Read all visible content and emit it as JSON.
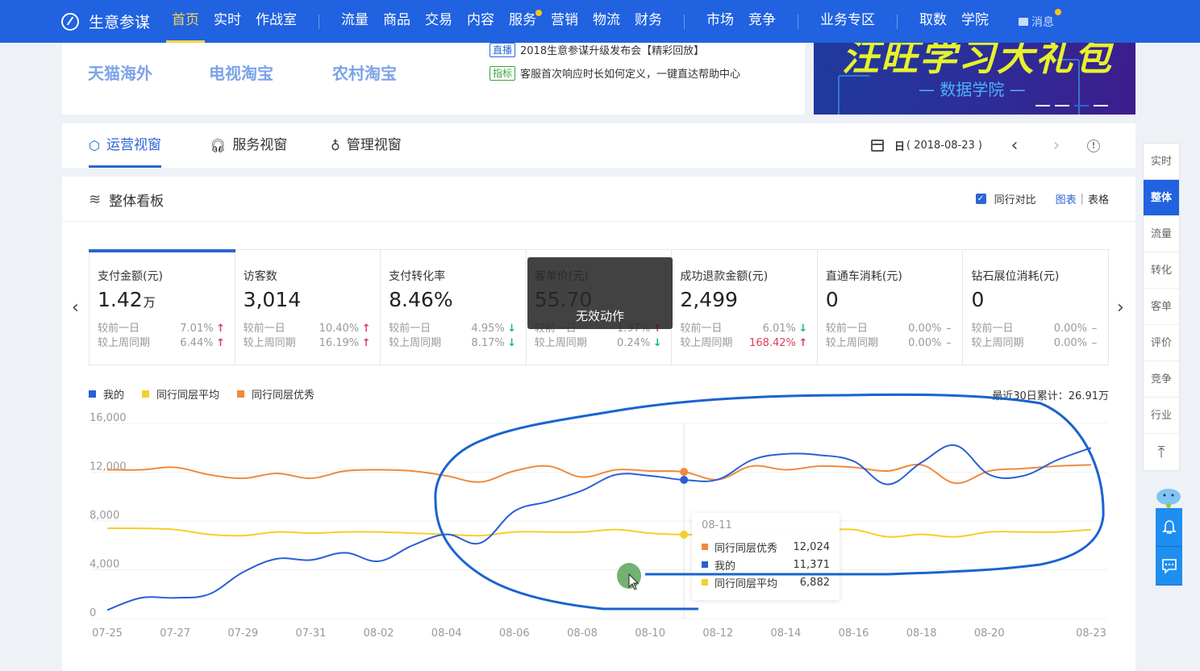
{
  "topnav": {
    "brand": "生意参谋",
    "groups": [
      [
        {
          "label": "首页",
          "active": true
        },
        {
          "label": "实时"
        },
        {
          "label": "作战室"
        }
      ],
      [
        {
          "label": "流量"
        },
        {
          "label": "商品"
        },
        {
          "label": "交易"
        },
        {
          "label": "内容"
        },
        {
          "label": "服务",
          "dot": true
        },
        {
          "label": "营销"
        },
        {
          "label": "物流"
        },
        {
          "label": "财务"
        }
      ],
      [
        {
          "label": "市场"
        },
        {
          "label": "竞争"
        }
      ],
      [
        {
          "label": "业务专区"
        }
      ],
      [
        {
          "label": "取数"
        },
        {
          "label": "学院"
        }
      ]
    ],
    "message_label": "消息",
    "accent_color": "#2062e0"
  },
  "quick_links": [
    "天猫海外",
    "电视淘宝",
    "农村淘宝"
  ],
  "news": [
    {
      "tag": "直播",
      "tag_color": "#2a66d6",
      "text": "2018生意参谋升级发布会【精彩回放】"
    },
    {
      "tag": "指标",
      "tag_color": "#3aa33a",
      "text": "客服首次响应时长如何定义，一键直达帮助中心"
    }
  ],
  "banner": {
    "title": "汪旺学习大礼包",
    "subtitle": "— 数据学院 —",
    "slides": 4,
    "current_slide": 3
  },
  "view_tabs": [
    {
      "label": "运营视窗",
      "icon": "shield-icon",
      "active": true
    },
    {
      "label": "服务视窗",
      "icon": "headset-icon"
    },
    {
      "label": "管理视窗",
      "icon": "tie-icon"
    }
  ],
  "date_picker": {
    "period": "日",
    "date": "( 2018-08-23 )"
  },
  "dashboard": {
    "title": "整体看板",
    "compare_label": "同行对比",
    "compare_checked": true,
    "view_chart": "图表",
    "view_table": "表格",
    "toast": "无效动作",
    "metrics": [
      {
        "title": "支付金额(元)",
        "value": "1.42",
        "unit": "万",
        "selected": true,
        "rows": [
          {
            "label": "较前一日",
            "pct": "7.01%",
            "trend": "up"
          },
          {
            "label": "较上周同期",
            "pct": "6.44%",
            "trend": "up"
          }
        ]
      },
      {
        "title": "访客数",
        "value": "3,014",
        "unit": "",
        "rows": [
          {
            "label": "较前一日",
            "pct": "10.40%",
            "trend": "up"
          },
          {
            "label": "较上周同期",
            "pct": "16.19%",
            "trend": "up"
          }
        ]
      },
      {
        "title": "支付转化率",
        "value": "8.46%",
        "unit": "",
        "rows": [
          {
            "label": "较前一日",
            "pct": "4.95%",
            "trend": "down"
          },
          {
            "label": "较上周同期",
            "pct": "8.17%",
            "trend": "down"
          }
        ]
      },
      {
        "title": "客单价(元)",
        "value": "55.70",
        "unit": "",
        "rows": [
          {
            "label": "较前一日",
            "pct": "1.97%",
            "trend": "up"
          },
          {
            "label": "较上周同期",
            "pct": "0.24%",
            "trend": "down"
          }
        ]
      },
      {
        "title": "成功退款金额(元)",
        "value": "2,499",
        "unit": "",
        "rows": [
          {
            "label": "较前一日",
            "pct": "6.01%",
            "trend": "down"
          },
          {
            "label": "较上周同期",
            "pct": "168.42%",
            "trend": "up",
            "highlight": true
          }
        ]
      },
      {
        "title": "直通车消耗(元)",
        "value": "0",
        "unit": "",
        "rows": [
          {
            "label": "较前一日",
            "pct": "0.00%",
            "trend": "flat"
          },
          {
            "label": "较上周同期",
            "pct": "0.00%",
            "trend": "flat"
          }
        ]
      },
      {
        "title": "钻石展位消耗(元)",
        "value": "0",
        "unit": "",
        "rows": [
          {
            "label": "较前一日",
            "pct": "0.00%",
            "trend": "flat"
          },
          {
            "label": "较上周同期",
            "pct": "0.00%",
            "trend": "flat"
          }
        ]
      }
    ],
    "total_label": "最近30日累计：26.91万",
    "tooltip": {
      "date": "08-11",
      "rows": [
        {
          "name": "同行同层优秀",
          "value": "12,024",
          "color": "#f08a3c"
        },
        {
          "name": "我的",
          "value": "11,371",
          "color": "#2a5fd6"
        },
        {
          "name": "同行同层平均",
          "value": "6,882",
          "color": "#f5cf2a"
        }
      ]
    }
  },
  "chart_data": {
    "type": "line",
    "title": "",
    "xlabel": "",
    "ylabel": "",
    "ylim": [
      0,
      16000
    ],
    "yticks": [
      "0",
      "4,000",
      "8,000",
      "12,000",
      "16,000"
    ],
    "ytick_values": [
      0,
      4000,
      8000,
      12000,
      16000
    ],
    "grid": true,
    "legend_position": "top-left",
    "x": [
      "07-25",
      "07-26",
      "07-27",
      "07-28",
      "07-29",
      "07-30",
      "07-31",
      "08-01",
      "08-02",
      "08-03",
      "08-04",
      "08-05",
      "08-06",
      "08-07",
      "08-08",
      "08-09",
      "08-10",
      "08-11",
      "08-12",
      "08-13",
      "08-14",
      "08-15",
      "08-16",
      "08-17",
      "08-18",
      "08-19",
      "08-20",
      "08-21",
      "08-22",
      "08-23"
    ],
    "xtick_labels": [
      "07-25",
      "07-27",
      "07-29",
      "07-31",
      "08-02",
      "08-04",
      "08-06",
      "08-08",
      "08-10",
      "08-12",
      "08-14",
      "08-16",
      "08-18",
      "08-20",
      "08-23"
    ],
    "highlight_x": "08-11",
    "series": [
      {
        "name": "我的",
        "color": "#2a5fd6",
        "values": [
          700,
          1700,
          1700,
          2000,
          3800,
          4900,
          4800,
          5400,
          4700,
          6000,
          6900,
          6200,
          8800,
          9600,
          10500,
          11800,
          11700,
          11371,
          11400,
          13000,
          13500,
          13400,
          12900,
          11000,
          12800,
          14200,
          11800,
          11700,
          13000,
          14000
        ]
      },
      {
        "name": "同行同层平均",
        "color": "#f5cf2a",
        "values": [
          7400,
          7400,
          7300,
          6900,
          6800,
          7100,
          7000,
          7100,
          7100,
          7000,
          6900,
          6800,
          7100,
          7100,
          7100,
          7300,
          7000,
          6882,
          6900,
          7000,
          7000,
          7200,
          7300,
          6700,
          6900,
          6700,
          7100,
          7100,
          7100,
          7300
        ]
      },
      {
        "name": "同行同层优秀",
        "color": "#f08a3c",
        "values": [
          12200,
          12200,
          12400,
          11800,
          11500,
          11900,
          11500,
          12100,
          12200,
          12100,
          11700,
          11200,
          12100,
          12500,
          11600,
          12200,
          12100,
          12024,
          11400,
          12500,
          12200,
          12500,
          12400,
          12100,
          12600,
          11100,
          12100,
          12300,
          12500,
          12600
        ]
      }
    ]
  },
  "side_nav": {
    "items": [
      "实时",
      "整体",
      "流量",
      "转化",
      "客单",
      "评价",
      "竞争",
      "行业"
    ],
    "active": "整体",
    "top_label": "↑"
  }
}
